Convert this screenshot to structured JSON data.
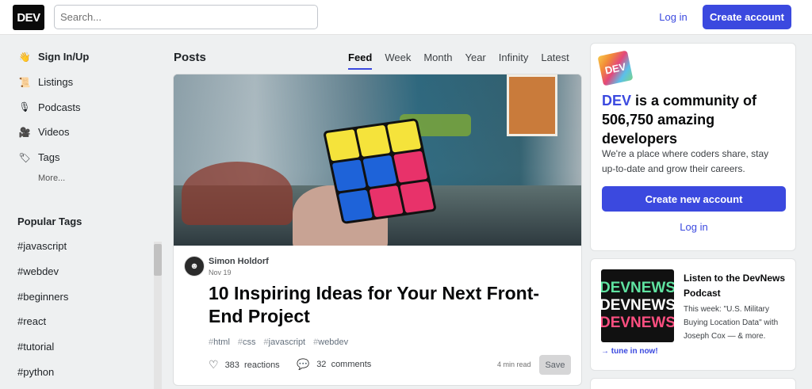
{
  "header": {
    "logo_text": "DEV",
    "search_placeholder": "Search...",
    "login_label": "Log in",
    "create_account_label": "Create account"
  },
  "sidebar": {
    "items": [
      {
        "label": "Sign In/Up",
        "icon": "hand-wave-icon",
        "glyph": "👋"
      },
      {
        "label": "Listings",
        "icon": "scroll-icon",
        "glyph": "📜"
      },
      {
        "label": "Podcasts",
        "icon": "microphone-icon",
        "glyph": "🎙"
      },
      {
        "label": "Videos",
        "icon": "video-camera-icon",
        "glyph": "🎥"
      },
      {
        "label": "Tags",
        "icon": "tag-icon",
        "glyph": "🏷"
      }
    ],
    "more_label": "More...",
    "popular_tags_title": "Popular Tags",
    "popular_tags": [
      "#javascript",
      "#webdev",
      "#beginners",
      "#react",
      "#tutorial",
      "#python"
    ]
  },
  "feed": {
    "title": "Posts",
    "tabs": [
      "Feed",
      "Week",
      "Month",
      "Year",
      "Infinity",
      "Latest"
    ],
    "active_tab": "Feed"
  },
  "article": {
    "author": "Simon Holdorf",
    "date": "Nov 19",
    "title": "10 Inspiring Ideas for Your Next Front-End Project",
    "tags": [
      "html",
      "css",
      "javascript",
      "webdev"
    ],
    "reactions_count": "383",
    "reactions_label": "reactions",
    "comments_count": "32",
    "comments_label": "comments",
    "read_time": "4 min read",
    "save_label": "Save"
  },
  "community": {
    "brand": "DEV",
    "headline_rest": " is a community of 506,750 amazing developers",
    "sub": "We're a place where coders share, stay up-to-date and grow their careers.",
    "create_label": "Create new account",
    "login_label": "Log in"
  },
  "podcast": {
    "art_line1": "DEVNEWS",
    "art_line2": "DEVNEWS",
    "art_line3": "DEVNEWS",
    "title": "Listen to the DevNews Podcast",
    "description": "This week: \"U.S. Military Buying Location Data\" with Joseph Cox — & more.",
    "tune_in": "→ tune in now!"
  },
  "colors": {
    "accent": "#3b49df",
    "background": "#eef0f1"
  }
}
